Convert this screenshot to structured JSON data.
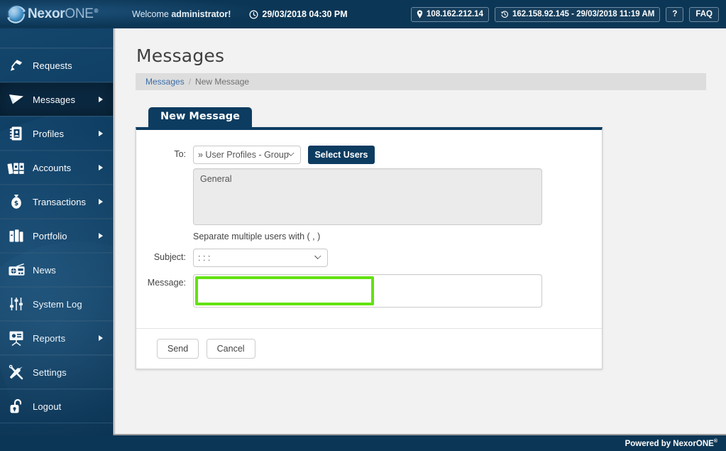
{
  "header": {
    "logo": {
      "primary": "Nexor",
      "secondary": "ONE",
      "registered": "®",
      "icon": "nexor-orb-logo"
    },
    "welcome_prefix": "Welcome ",
    "welcome_user": "administrator!",
    "datetime": "29/03/2018 04:30 PM",
    "datetime_icon": "clock-icon",
    "current_ip": "108.162.212.14",
    "current_ip_icon": "location-pin-icon",
    "last_login": "162.158.92.145 - 29/03/2018 11:19 AM",
    "last_login_icon": "history-clock-icon",
    "help_label": "?",
    "faq_label": "FAQ"
  },
  "sidebar": {
    "items": [
      {
        "label": "Requests",
        "icon": "desk-lamp-icon",
        "has_arrow": false,
        "active": false
      },
      {
        "label": "Messages",
        "icon": "paper-plane-icon",
        "has_arrow": true,
        "active": true
      },
      {
        "label": "Profiles",
        "icon": "address-book-icon",
        "has_arrow": true,
        "active": false
      },
      {
        "label": "Accounts",
        "icon": "binders-icon",
        "has_arrow": true,
        "active": false
      },
      {
        "label": "Transactions",
        "icon": "money-bag-icon",
        "has_arrow": true,
        "active": false
      },
      {
        "label": "Portfolio",
        "icon": "briefcase-icon",
        "has_arrow": true,
        "active": false
      },
      {
        "label": "News",
        "icon": "radio-icon",
        "has_arrow": false,
        "active": false
      },
      {
        "label": "System Log",
        "icon": "sliders-icon",
        "has_arrow": false,
        "active": false
      },
      {
        "label": "Reports",
        "icon": "presentation-icon",
        "has_arrow": true,
        "active": false
      },
      {
        "label": "Settings",
        "icon": "tools-icon",
        "has_arrow": false,
        "active": false
      },
      {
        "label": "Logout",
        "icon": "unlocked-lock-icon",
        "has_arrow": false,
        "active": false
      }
    ]
  },
  "main": {
    "page_title": "Messages",
    "breadcrumb": {
      "root": "Messages",
      "separator": "/",
      "current": "New Message"
    },
    "tab_label": "New Message",
    "form": {
      "to_label": "To:",
      "to_select_value": "» User Profiles - Group",
      "to_select_options": [
        "» User Profiles - Group"
      ],
      "select_users_button": "Select Users",
      "recipients_value": "General",
      "recipients_placeholder": "",
      "recipients_hint": "Separate multiple users with ( , )",
      "subject_label": "Subject:",
      "subject_select_value": ": : :",
      "subject_select_options": [
        ": : :"
      ],
      "message_label": "Message:",
      "message_value": "",
      "message_placeholder": ""
    },
    "actions": {
      "send_label": "Send",
      "cancel_label": "Cancel"
    }
  },
  "footer": {
    "text": "Powered by NexorONE",
    "registered": "®"
  },
  "colors": {
    "header_navy": "#0c3655",
    "sidebar_navy": "#0e3d62",
    "tab_navy": "#0d3c61",
    "accent_link": "#3b6ea8",
    "highlight_green": "#62e211",
    "page_bg": "#f2f2f2"
  }
}
